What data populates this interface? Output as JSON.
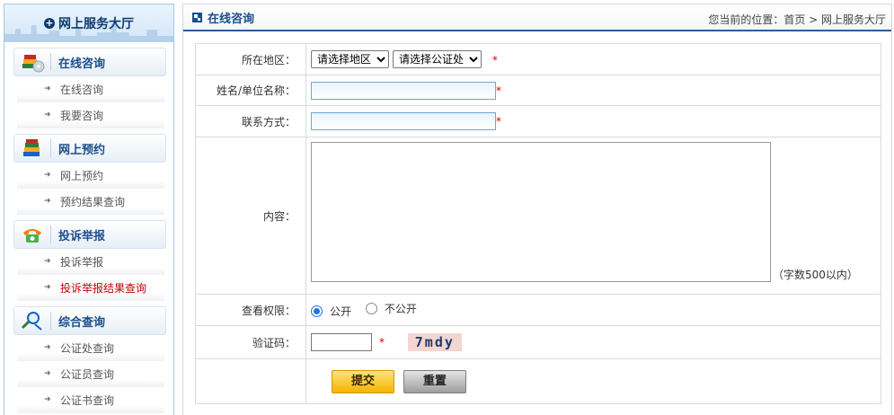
{
  "sidebar": {
    "title": "网上服务大厅",
    "sections": [
      {
        "title": "在线咨询",
        "icon": "books-cd-icon",
        "items": [
          {
            "label": "在线咨询"
          },
          {
            "label": "我要咨询"
          }
        ]
      },
      {
        "title": "网上预约",
        "icon": "books-icon",
        "items": [
          {
            "label": "网上预约"
          },
          {
            "label": "预约结果查询"
          }
        ]
      },
      {
        "title": "投诉举报",
        "icon": "telephone-icon",
        "items": [
          {
            "label": "投诉举报"
          },
          {
            "label": "投诉举报结果查询",
            "active": true
          }
        ]
      },
      {
        "title": "综合查询",
        "icon": "magnifier-icon",
        "items": [
          {
            "label": "公证处查询"
          },
          {
            "label": "公证员查询"
          },
          {
            "label": "公证书查询"
          }
        ]
      }
    ]
  },
  "header": {
    "title": "在线咨询",
    "breadcrumb": "您当前的位置：首页 > 网上服务大厅"
  },
  "form": {
    "region_label": "所在地区：",
    "region_select": "请选择地区",
    "office_select": "请选择公证处",
    "name_label": "姓名/单位名称：",
    "contact_label": "联系方式：",
    "content_label": "内容：",
    "content_hint": "（字数500以内）",
    "permission_label": "查看权限：",
    "public_label": "公开",
    "private_label": "不公开",
    "captcha_label": "验证码：",
    "captcha_text": "7mdy",
    "required_mark": "*",
    "submit_label": "提交",
    "reset_label": "重置"
  },
  "colors": {
    "accent": "#1b4e8c",
    "required": "#dd0000",
    "active_link": "#c00000"
  }
}
